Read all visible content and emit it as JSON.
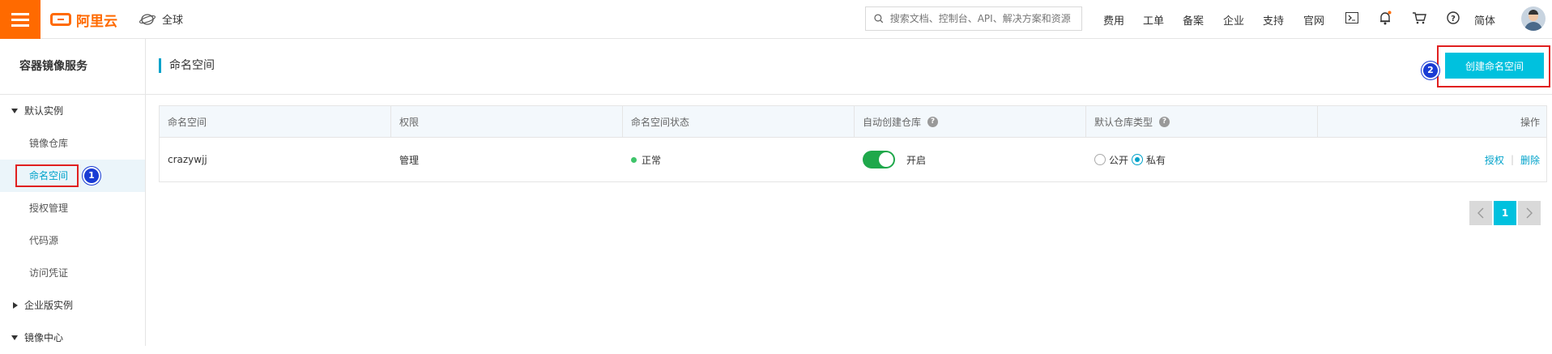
{
  "topbar": {
    "logo_text": "阿里云",
    "region": "全球",
    "search_placeholder": "搜索文档、控制台、API、解决方案和资源",
    "links": [
      "费用",
      "工单",
      "备案",
      "企业",
      "支持",
      "官网"
    ],
    "lang": "简体",
    "accent_color": "#ff6a00"
  },
  "sidebar": {
    "title": "容器镜像服务",
    "group_default": "默认实例",
    "items": [
      "镜像仓库",
      "命名空间",
      "授权管理",
      "代码源",
      "访问凭证"
    ],
    "group_enterprise": "企业版实例",
    "group_mirror": "镜像中心"
  },
  "main": {
    "title": "命名空间",
    "create_button": "创建命名空间",
    "table": {
      "headers": [
        "命名空间",
        "权限",
        "命名空间状态",
        "自动创建仓库",
        "默认仓库类型",
        "操作"
      ],
      "row": {
        "namespace": "crazywjj",
        "permission": "管理",
        "status": "正常",
        "auto_create": "开启",
        "type_public": "公开",
        "type_private": "私有",
        "action_auth": "授权",
        "action_delete": "删除"
      }
    },
    "pagination": {
      "current": "1"
    }
  },
  "annotations": {
    "badge1": "1",
    "badge2": "2"
  },
  "colors": {
    "primary": "#00c1de",
    "highlight": "#e02020",
    "badge": "#1a3cd4"
  }
}
